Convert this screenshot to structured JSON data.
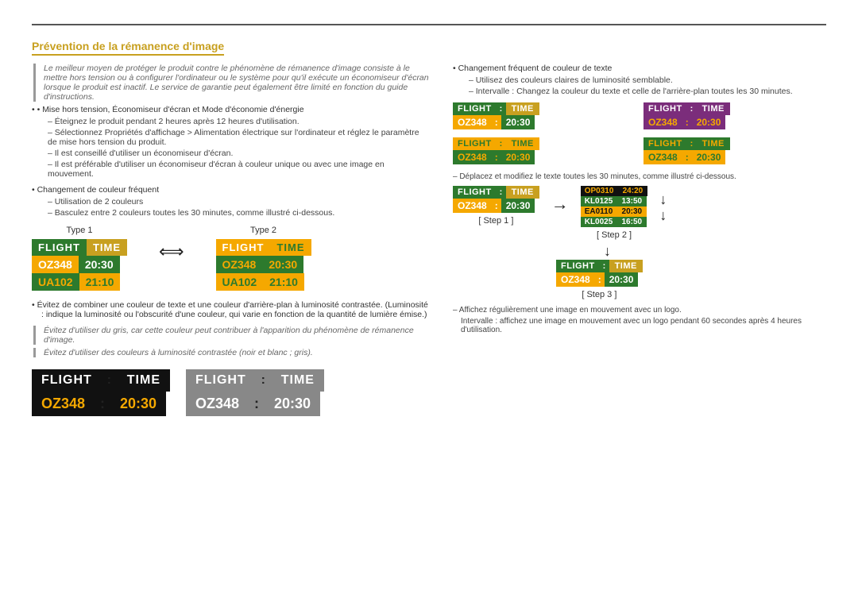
{
  "page": {
    "title": "Prévention de la rémanence d'image"
  },
  "left": {
    "intro": "Le meilleur moyen de protéger le produit contre le phénomène de rémanence d'image consiste à le mettre hors tension ou à configurer l'ordinateur ou le système pour qu'il exécute un économiseur d'écran lorsque le produit est inactif. Le service de garantie peut également être limité en fonction du guide d'instructions.",
    "bullets": [
      {
        "title": "Mise hors tension, Économiseur d'écran et Mode d'économie d'énergie",
        "subs": [
          "Éteignez le produit pendant 2 heures après 12 heures d'utilisation.",
          "Sélectionnez Propriétés d'affichage > Alimentation électrique sur l'ordinateur et réglez le paramètre de mise hors tension du produit.",
          "Il est conseillé d'utiliser un économiseur d'écran.",
          "Il est préférable d'utiliser un économiseur d'écran à couleur unique ou avec une image en mouvement."
        ]
      },
      {
        "title": "Changement de couleur fréquent",
        "subs": [
          "Utilisation de 2 couleurs",
          "Basculez entre 2 couleurs toutes les 30 minutes, comme illustré ci-dessous."
        ]
      }
    ],
    "type1_label": "Type 1",
    "type2_label": "Type 2",
    "bullet2": {
      "title": "Évitez de combiner une couleur de texte et une couleur d'arrière-plan à luminosité contrastée. (Luminosité : indique la luminosité ou l'obscurité d'une couleur, qui varie en fonction de la quantité de lumière émise.)"
    },
    "italic1": "Évitez d'utiliser du gris, car cette couleur peut contribuer à l'apparition du phénomène de rémanence d'image.",
    "italic2": "Évitez d'utiliser des couleurs à luminosité contrastée (noir et blanc ; gris).",
    "boards": {
      "type1": {
        "h1": "FLIGHT",
        "h2": "TIME",
        "r1c1": "OZ348",
        "r1c2": "20:30",
        "r2c1": "UA102",
        "r2c2": "21:10"
      },
      "type2": {
        "h1": "FLIGHT",
        "h2": "TIME",
        "r1c1": "OZ348",
        "r1c2": "20:30",
        "r2c1": "UA102",
        "r2c2": "21:10"
      }
    },
    "bottomBoards": {
      "black": {
        "h1": "FLIGHT",
        "colon": ":",
        "h2": "TIME",
        "r1c1": "OZ348",
        "r1colon": ":",
        "r1c2": "20:30"
      },
      "gray": {
        "h1": "FLIGHT",
        "colon": ":",
        "h2": "TIME",
        "r1c1": "OZ348",
        "r1colon": ":",
        "r1c2": "20:30"
      }
    }
  },
  "right": {
    "bullet1": {
      "title": "Changement fréquent de couleur de texte",
      "subs": [
        "Utilisez des couleurs claires de luminosité semblable.",
        "Intervalle : Changez la couleur du texte et celle de l'arrière-plan toutes les 30 minutes."
      ]
    },
    "boards": {
      "b1": {
        "h1": "FLIGHT",
        "colon": ":",
        "h2": "TIME",
        "r1": "OZ348",
        "r1c": ":",
        "r2": "20:30"
      },
      "b2": {
        "h1": "FLIGHT",
        "colon": ":",
        "h2": "TIME",
        "r1": "OZ348",
        "r1c": ":",
        "r2": "20:30"
      },
      "b3": {
        "h1": "FLIGHT",
        "colon": ":",
        "h2": "TIME",
        "r1": "OZ348",
        "r1c": ":",
        "r2": "20:30"
      },
      "b4": {
        "h1": "FLIGHT",
        "colon": ":",
        "h2": "TIME",
        "r1": "OZ348",
        "r1c": ":",
        "r2": "20:30"
      }
    },
    "step_note": "– Déplacez et modifiez le texte toutes les 30 minutes, comme illustré ci-dessous.",
    "step1_label": "[ Step 1 ]",
    "step2_label": "[ Step 2 ]",
    "step3_label": "[ Step 3 ]",
    "step1_board": {
      "h1": "FLIGHT",
      "colon": ":",
      "h2": "TIME",
      "r1": "OZ348",
      "r1c": ":",
      "r2": "20:30"
    },
    "step2_rows": [
      {
        "c1": "OP0310",
        "c2": "24:20"
      },
      {
        "c1": "KL0125",
        "c2": "13:50"
      },
      {
        "c1": "EA0110",
        "c2": "20:30"
      },
      {
        "c1": "KL0025",
        "c2": "16:50"
      }
    ],
    "step3_board": {
      "h1": "FLIGHT",
      "colon": ":",
      "h2": "TIME",
      "r1": "OZ348",
      "r1c": ":",
      "r2": "20:30"
    },
    "final_note": "– Affichez régulièrement une image en mouvement avec un logo.",
    "final_note2": "Intervalle : affichez une image en mouvement avec un logo pendant 60 secondes après 4 heures d'utilisation."
  }
}
